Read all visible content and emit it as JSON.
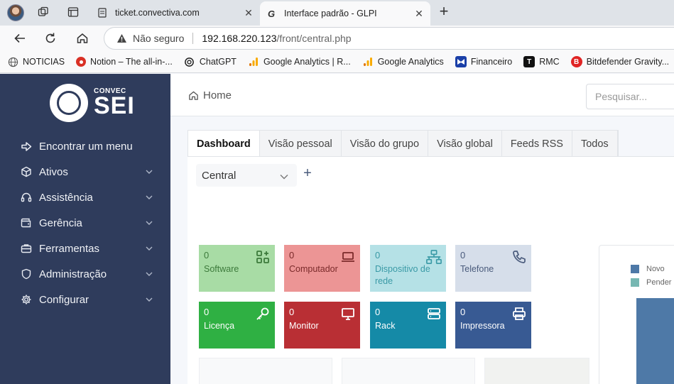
{
  "browser": {
    "tabs": [
      {
        "title": "ticket.convectiva.com",
        "active": false
      },
      {
        "title": "Interface padrão - GLPI",
        "active": true
      }
    ],
    "address": {
      "security": "Não seguro",
      "host": "192.168.220.123",
      "path": "/front/central.php"
    },
    "bookmarks": [
      {
        "label": "NOTICIAS",
        "icon": "globe-icon",
        "color": "#555555"
      },
      {
        "label": "Notion – The all-in-...",
        "icon": "notion-icon",
        "color": "#d93025"
      },
      {
        "label": "ChatGPT",
        "icon": "chatgpt-icon",
        "color": "#222222"
      },
      {
        "label": "Google Analytics | R...",
        "icon": "analytics-icon",
        "color": "#f9ab00"
      },
      {
        "label": "Google Analytics",
        "icon": "analytics-icon",
        "color": "#f9ab00"
      },
      {
        "label": "Financeiro",
        "icon": "financeiro-icon",
        "color": "#1a3fa8"
      },
      {
        "label": "RMC",
        "icon": "rmc-icon",
        "color": "#111111"
      },
      {
        "label": "Bitdefender Gravity...",
        "icon": "bitdefender-icon",
        "color": "#e02424"
      }
    ]
  },
  "app": {
    "logo": {
      "top": "CONVEC",
      "big": "SEI"
    },
    "menu": [
      {
        "label": "Encontrar um menu",
        "icon": "arrow-right-icon",
        "chevron": false
      },
      {
        "label": "Ativos",
        "icon": "cube-icon",
        "chevron": true
      },
      {
        "label": "Assistência",
        "icon": "headset-icon",
        "chevron": true
      },
      {
        "label": "Gerência",
        "icon": "wallet-icon",
        "chevron": true
      },
      {
        "label": "Ferramentas",
        "icon": "briefcase-icon",
        "chevron": true
      },
      {
        "label": "Administração",
        "icon": "shield-icon",
        "chevron": true
      },
      {
        "label": "Configurar",
        "icon": "gear-icon",
        "chevron": true
      }
    ],
    "breadcrumb": "Home",
    "search_placeholder": "Pesquisar...",
    "tabs": [
      "Dashboard",
      "Visão pessoal",
      "Visão do grupo",
      "Visão global",
      "Feeds RSS",
      "Todos"
    ],
    "dashboard_select": "Central",
    "cards": [
      {
        "count": "0",
        "label": "Software",
        "icon": "apps-add-icon",
        "bg": "#a8dca5",
        "fg": "#3c7a3b"
      },
      {
        "count": "0",
        "label": "Computador",
        "icon": "laptop-icon",
        "bg": "#ec9595",
        "fg": "#7a2a2a"
      },
      {
        "count": "0",
        "label": "Dispositivo de rede",
        "icon": "network-icon",
        "bg": "#b5e1e6",
        "fg": "#3a9aa6"
      },
      {
        "count": "0",
        "label": "Telefone",
        "icon": "phone-icon",
        "bg": "#d6deea",
        "fg": "#4a5b7c"
      },
      {
        "count": "0",
        "label": "Licença",
        "icon": "key-icon",
        "bg": "#2fb043",
        "fg": "#ffffff"
      },
      {
        "count": "0",
        "label": "Monitor",
        "icon": "monitor-icon",
        "bg": "#b92f34",
        "fg": "#ffffff"
      },
      {
        "count": "0",
        "label": "Rack",
        "icon": "server-icon",
        "bg": "#158aa7",
        "fg": "#ffffff"
      },
      {
        "count": "0",
        "label": "Impressora",
        "icon": "printer-icon",
        "bg": "#385a93",
        "fg": "#ffffff"
      }
    ],
    "chart_legend": [
      {
        "label": "Novo",
        "color": "#4e79a7"
      },
      {
        "label": "Pender",
        "color": "#76b7b2"
      }
    ]
  }
}
